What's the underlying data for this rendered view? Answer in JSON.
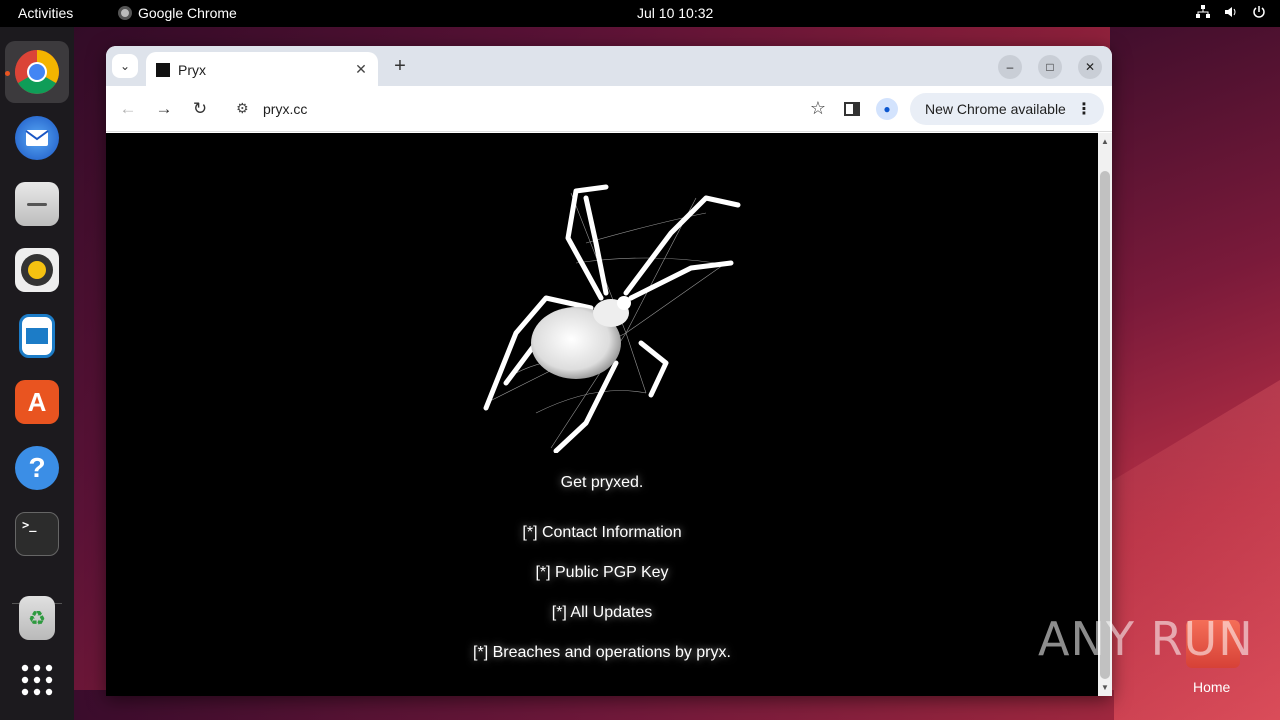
{
  "topbar": {
    "activities": "Activities",
    "app_name": "Google Chrome",
    "clock": "Jul 10  10:32"
  },
  "dock": {
    "items": [
      {
        "name": "chrome",
        "icon": "chrome-icon",
        "color": "#4285f4"
      },
      {
        "name": "thunderbird",
        "icon": "mail-icon",
        "color": "#1f6fd1"
      },
      {
        "name": "files",
        "icon": "folder-icon",
        "color": "#d9d9d9"
      },
      {
        "name": "rhythmbox",
        "icon": "speaker-icon",
        "color": "#f5c211"
      },
      {
        "name": "writer",
        "icon": "document-icon",
        "color": "#1c7cc7"
      },
      {
        "name": "app-center",
        "icon": "store-icon",
        "color": "#e95420"
      },
      {
        "name": "help",
        "icon": "help-icon",
        "color": "#3b8ee6"
      },
      {
        "name": "terminal",
        "icon": "terminal-icon",
        "color": "#2c2c2c"
      },
      {
        "name": "trash",
        "icon": "trash-icon",
        "color": "#cfcfcf"
      },
      {
        "name": "app-grid",
        "icon": "grid-icon",
        "color": "#ffffff"
      }
    ],
    "terminal_prompt": ">_"
  },
  "browser": {
    "tab_title": "Pryx",
    "url": "pryx.cc",
    "update_label": "New Chrome available"
  },
  "page": {
    "tagline": "Get pryxed.",
    "links": [
      "[*] Contact Information",
      "[*] Public PGP Key",
      "[*] All Updates",
      "[*] Breaches and operations by pryx."
    ]
  },
  "desktop": {
    "watermark": "ANY RUN",
    "home_label": "Home"
  }
}
